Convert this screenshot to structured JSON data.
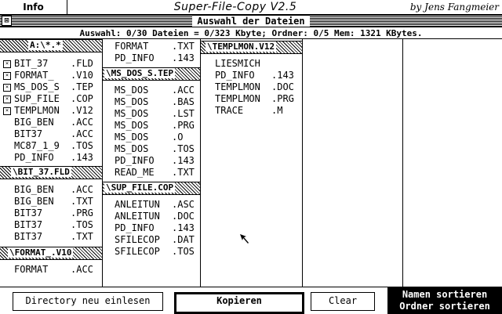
{
  "menubar": {
    "info": "Info",
    "title": "Super-File-Copy V2.5",
    "author": "by Jens Fangmeier"
  },
  "window": {
    "close": "⊠",
    "title": "Auswahl der Dateien",
    "status": "Auswahl: 0/30 Dateien = 0/323 Kbyte; Ordner: 0/5 Mem: 1321 KBytes."
  },
  "columns": {
    "root": {
      "header": "A:\\*.*",
      "files": [
        {
          "name": "BIT_37",
          "ext": ".FLD",
          "folder": true
        },
        {
          "name": "FORMAT_",
          "ext": ".V10",
          "folder": true
        },
        {
          "name": "MS_DOS_S",
          "ext": ".TEP",
          "folder": true
        },
        {
          "name": "SUP_FILE",
          "ext": ".COP",
          "folder": true
        },
        {
          "name": "TEMPLMON",
          "ext": ".V12",
          "folder": true
        },
        {
          "name": "BIG_BEN",
          "ext": ".ACC",
          "folder": false
        },
        {
          "name": "BIT37",
          "ext": ".ACC",
          "folder": false
        },
        {
          "name": "MC87_1_9",
          "ext": ".TOS",
          "folder": false
        },
        {
          "name": "PD_INFO",
          "ext": ".143",
          "folder": false
        }
      ]
    },
    "bit37": {
      "header": "\\BIT_37.FLD",
      "files": [
        {
          "name": "BIG_BEN",
          "ext": ".ACC"
        },
        {
          "name": "BIG_BEN",
          "ext": ".TXT"
        },
        {
          "name": "BIT37",
          "ext": ".PRG"
        },
        {
          "name": "BIT37",
          "ext": ".TOS"
        },
        {
          "name": "BIT37",
          "ext": ".TXT"
        }
      ]
    },
    "format": {
      "header": "\\FORMAT_.V10",
      "files": [
        {
          "name": "FORMAT",
          "ext": ".ACC"
        }
      ]
    },
    "col2top": {
      "files": [
        {
          "name": "FORMAT",
          "ext": ".TXT"
        },
        {
          "name": "PD_INFO",
          "ext": ".143"
        }
      ]
    },
    "msdos": {
      "header": "\\MS_DOS_S.TEP",
      "files": [
        {
          "name": "MS_DOS",
          "ext": ".ACC"
        },
        {
          "name": "MS_DOS",
          "ext": ".BAS"
        },
        {
          "name": "MS_DOS",
          "ext": ".LST"
        },
        {
          "name": "MS_DOS",
          "ext": ".PRG"
        },
        {
          "name": "MS_DOS",
          "ext": ".O"
        },
        {
          "name": "MS_DOS",
          "ext": ".TOS"
        },
        {
          "name": "PD_INFO",
          "ext": ".143"
        },
        {
          "name": "READ_ME",
          "ext": ".TXT"
        }
      ]
    },
    "supfile": {
      "header": "\\SUP_FILE.COP",
      "files": [
        {
          "name": "ANLEITUN",
          "ext": ".ASC"
        },
        {
          "name": "ANLEITUN",
          "ext": ".DOC"
        },
        {
          "name": "PD_INFO",
          "ext": ".143"
        },
        {
          "name": "SFILECOP",
          "ext": ".DAT"
        },
        {
          "name": "SFILECOP",
          "ext": ".TOS"
        }
      ]
    },
    "templmon": {
      "header": "\\TEMPLMON.V12",
      "files": [
        {
          "name": "LIESMICH",
          "ext": ""
        },
        {
          "name": "PD_INFO",
          "ext": ".143"
        },
        {
          "name": "TEMPLMON",
          "ext": ".DOC"
        },
        {
          "name": "TEMPLMON",
          "ext": ".PRG"
        },
        {
          "name": "TRACE",
          "ext": ".M"
        }
      ]
    }
  },
  "buttons": {
    "reload": "Directory neu einlesen",
    "copy": "Kopieren",
    "clear": "Clear",
    "sort_names": "Namen sortieren",
    "sort_folders": "Ordner sortieren"
  }
}
